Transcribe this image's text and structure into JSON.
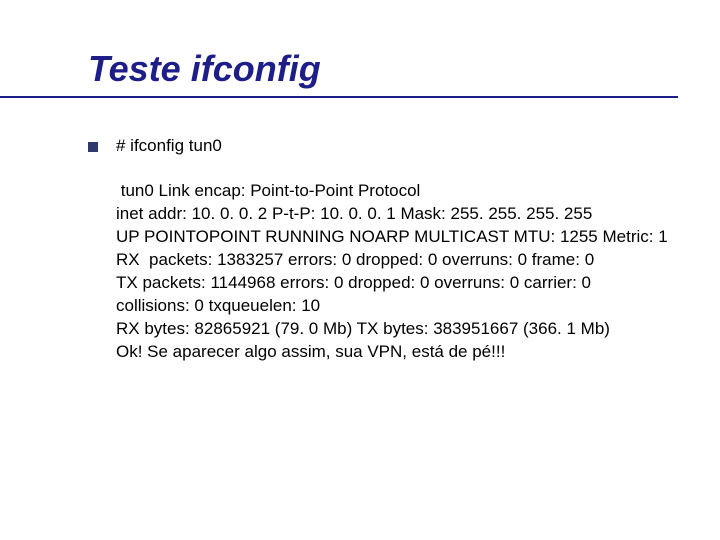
{
  "title": "Teste ifconfig",
  "command": "# ifconfig tun0",
  "output": {
    "line1": " tun0 Link encap: Point-to-Point Protocol",
    "line2": "inet addr: 10. 0. 0. 2 P-t-P: 10. 0. 0. 1 Mask: 255. 255. 255. 255",
    "line3": "UP POINTOPOINT RUNNING NOARP MULTICAST MTU: 1255 Metric: 1",
    "line4": "RX  packets: 1383257 errors: 0 dropped: 0 overruns: 0 frame: 0",
    "line5": "TX packets: 1144968 errors: 0 dropped: 0 overruns: 0 carrier: 0",
    "line6": "collisions: 0 txqueuelen: 10",
    "line7": "RX bytes: 82865921 (79. 0 Mb) TX bytes: 383951667 (366. 1 Mb)",
    "line8": "Ok! Se aparecer algo assim, sua VPN, está de pé!!!"
  }
}
